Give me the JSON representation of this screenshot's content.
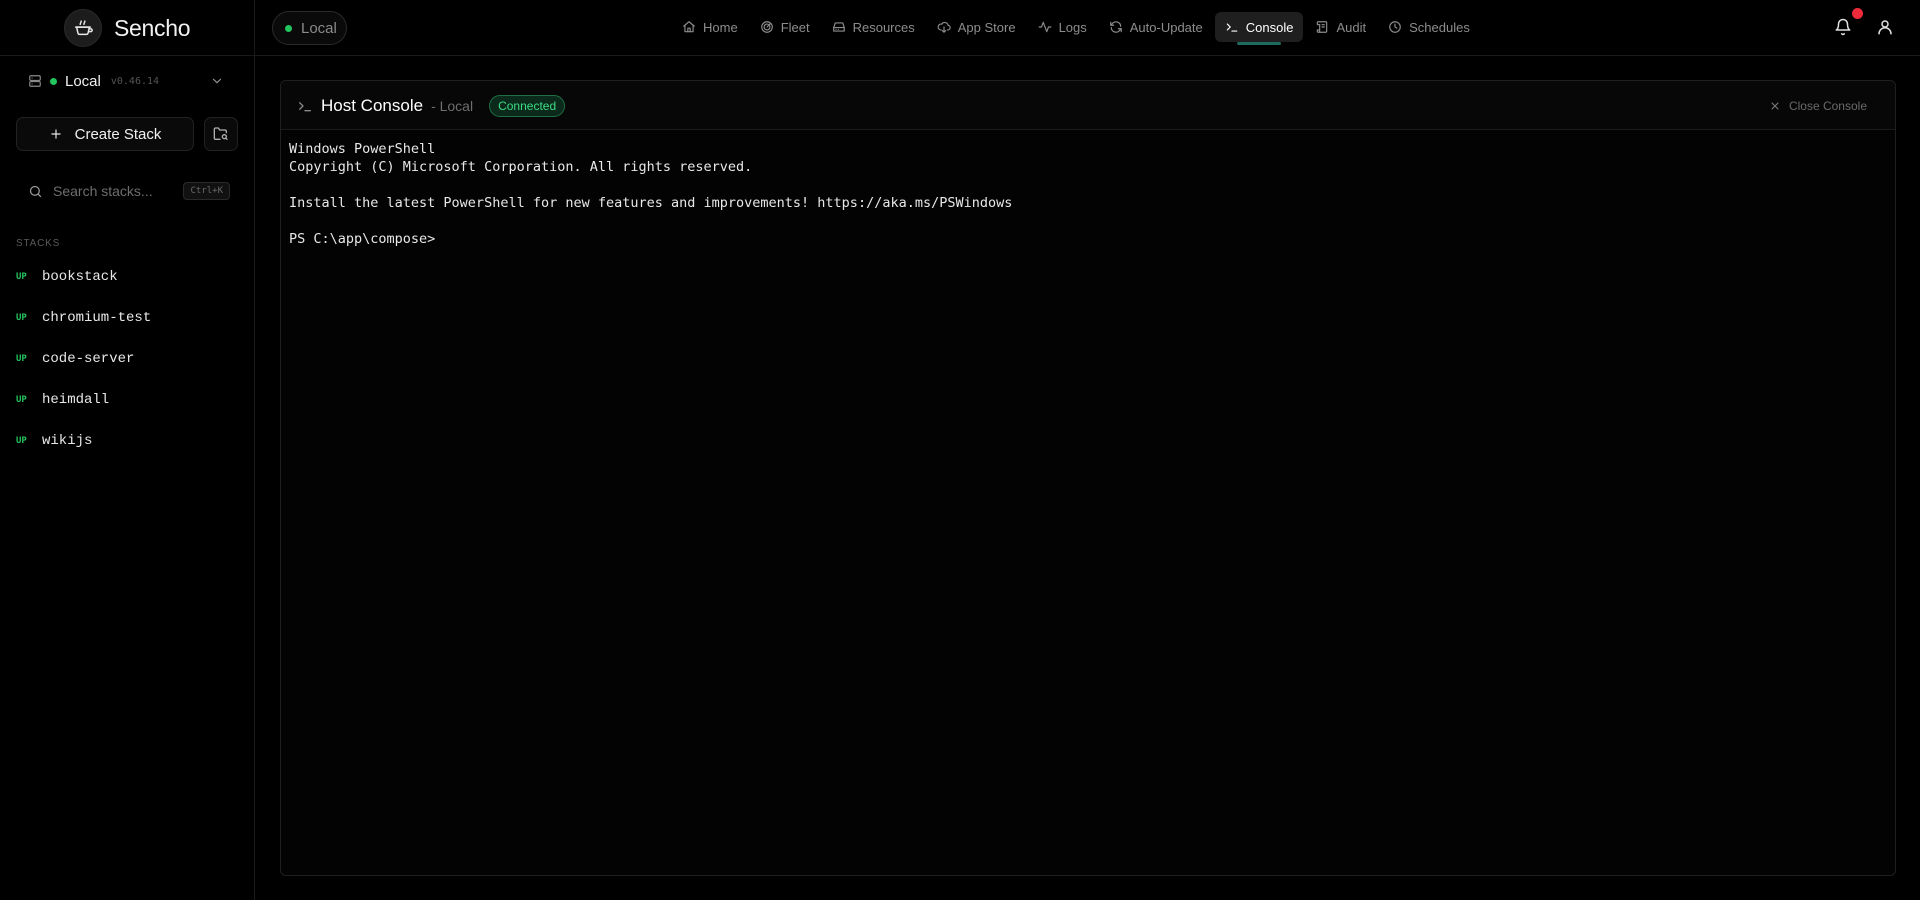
{
  "app": {
    "name": "Sencho"
  },
  "environment": {
    "label": "Local"
  },
  "nav": {
    "items": [
      {
        "label": "Home",
        "icon": "home-icon",
        "active": false
      },
      {
        "label": "Fleet",
        "icon": "radar-icon",
        "active": false
      },
      {
        "label": "Resources",
        "icon": "hard-drive-icon",
        "active": false
      },
      {
        "label": "App Store",
        "icon": "cloud-download-icon",
        "active": false
      },
      {
        "label": "Logs",
        "icon": "activity-icon",
        "active": false
      },
      {
        "label": "Auto-Update",
        "icon": "refresh-icon",
        "active": false
      },
      {
        "label": "Console",
        "icon": "terminal-icon",
        "active": true
      },
      {
        "label": "Audit",
        "icon": "scroll-icon",
        "active": false
      },
      {
        "label": "Schedules",
        "icon": "clock-icon",
        "active": false
      }
    ]
  },
  "header_icons": [
    "bell-icon",
    "user-icon"
  ],
  "sidebar": {
    "host": {
      "name": "Local",
      "version": "v0.46.14"
    },
    "create_label": "Create Stack",
    "search": {
      "placeholder": "Search stacks...",
      "shortcut": "Ctrl+K"
    },
    "section_label": "STACKS",
    "stacks": [
      {
        "status": "UP",
        "name": "bookstack"
      },
      {
        "status": "UP",
        "name": "chromium-test"
      },
      {
        "status": "UP",
        "name": "code-server"
      },
      {
        "status": "UP",
        "name": "heimdall"
      },
      {
        "status": "UP",
        "name": "wikijs"
      }
    ]
  },
  "console": {
    "title": "Host Console",
    "host": "- Local",
    "status": "Connected",
    "close_label": "Close Console",
    "lines": [
      "Windows PowerShell",
      "Copyright (C) Microsoft Corporation. All rights reserved.",
      "",
      "Install the latest PowerShell for new features and improvements! https://aka.ms/PSWindows",
      "",
      "PS C:\\app\\compose>"
    ]
  },
  "colors": {
    "background": "#000000",
    "accent_green": "#22c55e",
    "badge_red": "#ef2b3b",
    "active_underline": "#1e6a5c"
  }
}
